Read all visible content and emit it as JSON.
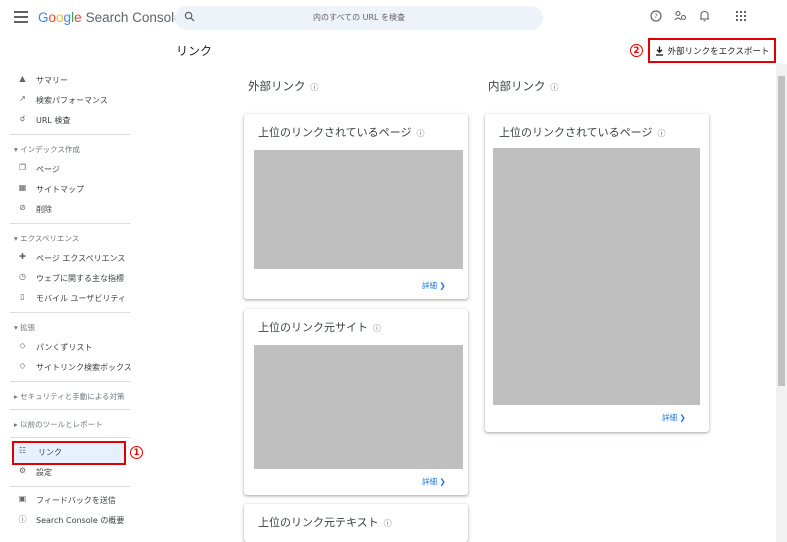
{
  "topbar": {
    "logo_google": [
      "G",
      "o",
      "o",
      "g",
      "l",
      "e"
    ],
    "logo_product": "Search Console",
    "search_placeholder": "内のすべての URL を検査"
  },
  "header": {
    "page_title": "リンク",
    "export_label": "外部リンクをエクスポート",
    "marker_export": "2"
  },
  "sidebar": {
    "items": [
      {
        "icon": "home-icon",
        "label": "サマリー"
      },
      {
        "icon": "trending-icon",
        "label": "検索パフォーマンス"
      },
      {
        "icon": "search-icon",
        "label": "URL 検査"
      }
    ],
    "section_index": "インデックス作成",
    "index_items": [
      {
        "icon": "pages-icon",
        "label": "ページ"
      },
      {
        "icon": "sitemap-icon",
        "label": "サイトマップ"
      },
      {
        "icon": "removals-icon",
        "label": "削除"
      }
    ],
    "section_experience": "エクスペリエンス",
    "experience_items": [
      {
        "icon": "page-experience-icon",
        "label": "ページ エクスペリエンス"
      },
      {
        "icon": "web-vitals-icon",
        "label": "ウェブに関する主な指標"
      },
      {
        "icon": "mobile-icon",
        "label": "モバイル ユーザビリティ"
      }
    ],
    "section_enhancements": "拡張",
    "enhancement_items": [
      {
        "icon": "breadcrumb-icon",
        "label": "パンくずリスト"
      },
      {
        "icon": "sitelinks-icon",
        "label": "サイトリンク検索ボックス"
      }
    ],
    "section_security": "セキュリティと手動による対策",
    "section_legacy": "以前のツールとレポート",
    "links_label": "リンク",
    "marker_links": "1",
    "settings_label": "設定",
    "feedback_label": "フィードバックを送信",
    "about_label": "Search Console の概要"
  },
  "external": {
    "heading": "外部リンク",
    "card1_title": "上位のリンクされているページ",
    "card2_title": "上位のリンク元サイト",
    "card3_title": "上位のリンク元テキスト",
    "more_label": "詳細"
  },
  "internal": {
    "heading": "内部リンク",
    "card1_title": "上位のリンクされているページ",
    "more_label": "詳細"
  },
  "colors": {
    "accent": "#1a73e8",
    "highlight_red": "#e00000",
    "selected_bg": "#e8f0fe",
    "placeholder_gray": "#bfbfbf"
  }
}
